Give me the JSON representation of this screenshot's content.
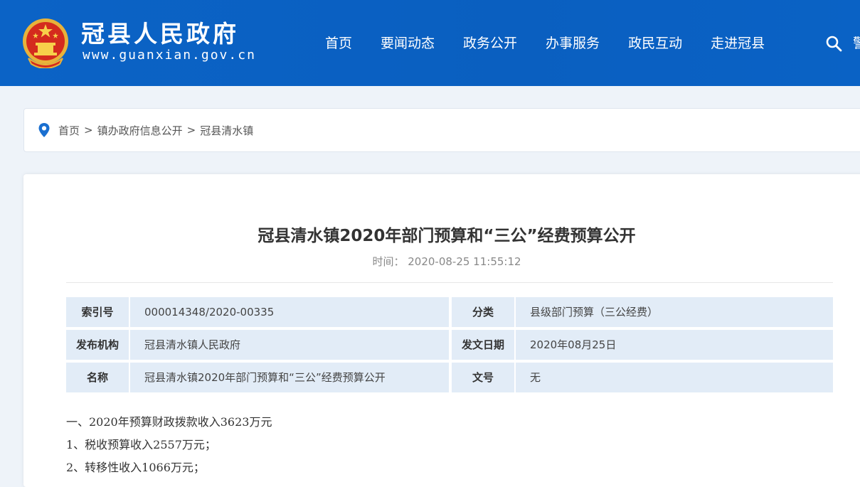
{
  "header": {
    "site_name": "冠县人民政府",
    "site_url": "www.guanxian.gov.cn",
    "nav": [
      "首页",
      "要闻动态",
      "政务公开",
      "办事服务",
      "政民互动",
      "走进冠县"
    ],
    "nav_clipped": "警",
    "brand_color": "#0b63c6"
  },
  "breadcrumb": {
    "items": [
      "首页",
      "镇办政府信息公开",
      "冠县清水镇"
    ],
    "separator": ">"
  },
  "article": {
    "title": "冠县清水镇2020年部门预算和“三公”经费预算公开",
    "time_label": "时间：",
    "time_value": "2020-08-25 11:55:12",
    "info": {
      "row1": {
        "k1": "索引号",
        "v1": "000014348/2020-00335",
        "k2": "分类",
        "v2": "县级部门预算（三公经费）"
      },
      "row2": {
        "k1": "发布机构",
        "v1": "冠县清水镇人民政府",
        "k2": "发文日期",
        "v2": "2020年08月25日"
      },
      "row3": {
        "k1": "名称",
        "v1": "冠县清水镇2020年部门预算和“三公”经费预算公开",
        "k2": "文号",
        "v2": "无"
      }
    },
    "paragraphs": [
      "一、2020年预算财政拨款收入3623万元",
      "1、税收预算收入2557万元；",
      "2、转移性收入1066万元；"
    ]
  }
}
